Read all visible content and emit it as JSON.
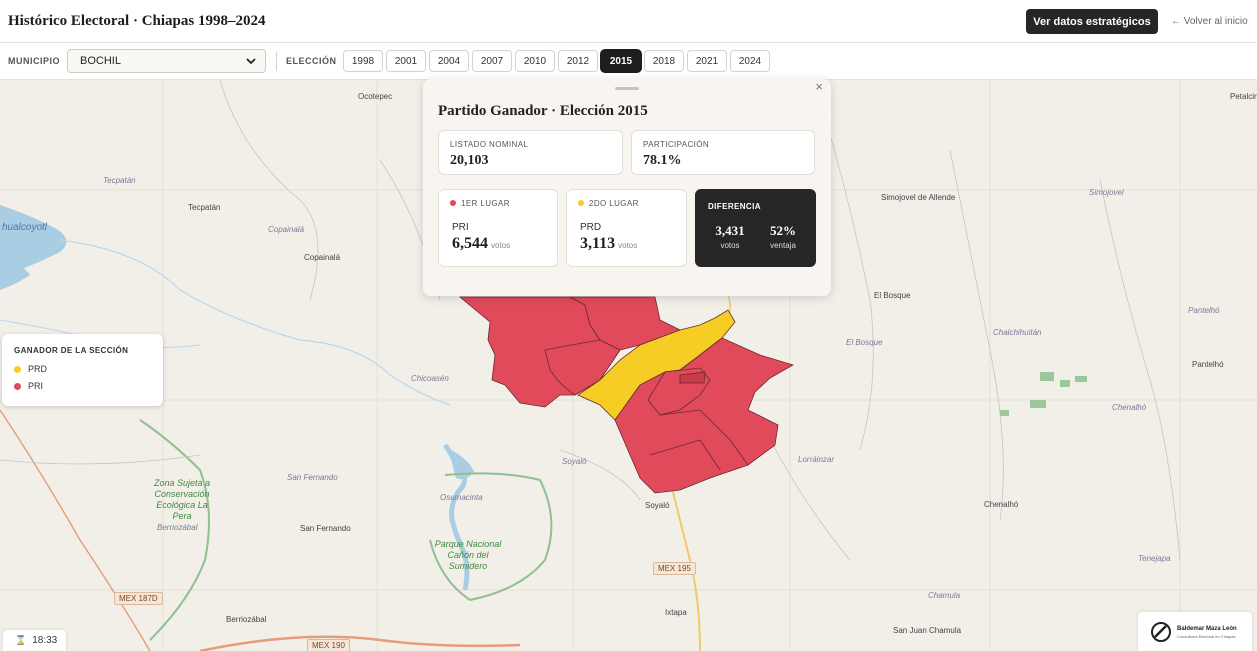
{
  "header": {
    "title": "Histórico Electoral · Chiapas 1998–2024",
    "strategic_button": "Ver datos estratégicos",
    "back_link": "← Volver al inicio"
  },
  "toolbar": {
    "municipio_label": "MUNICIPIO",
    "municipio_value": "BOCHIL",
    "eleccion_label": "ELECCIÓN",
    "years": [
      "1998",
      "2001",
      "2004",
      "2007",
      "2010",
      "2012",
      "2015",
      "2018",
      "2021",
      "2024"
    ],
    "selected_year": "2015"
  },
  "colors": {
    "pri": "#e04a5a",
    "prd": "#f6cd24",
    "dark": "#262626"
  },
  "panel": {
    "title": "Partido Ganador · Elección 2015",
    "close_icon": "×",
    "listado_label": "LISTADO NOMINAL",
    "listado_value": "20,103",
    "participacion_label": "PARTICIPACIÓN",
    "participacion_value": "78.1%",
    "first": {
      "label": "1ER LUGAR",
      "party": "PRI",
      "votes": "6,544",
      "unit": "votos"
    },
    "second": {
      "label": "2DO LUGAR",
      "party": "PRD",
      "votes": "3,113",
      "unit": "votos"
    },
    "diff": {
      "label": "DIFERENCIA",
      "votes": "3,431",
      "votes_unit": "votos",
      "pct": "52%",
      "pct_unit": "ventaja"
    }
  },
  "legend": {
    "title": "GANADOR DE LA SECCIÓN",
    "items": [
      "PRD",
      "PRI"
    ]
  },
  "timer": {
    "icon": "hourglass-icon",
    "time": "18:33"
  },
  "brand": {
    "name": "Baldemar Maza León",
    "subtitle": "Consultoría Electoral en Chiapas",
    "icon": "brand-logo-icon"
  },
  "map": {
    "places": [
      "Ocotepec",
      "Tecpatán",
      "Copainalá",
      "Chicoasén",
      "San Fernando",
      "Berriozábal",
      "Soyaló",
      "Ixtapa",
      "El Bosque",
      "Pantelhó",
      "Chenalhó",
      "San Juan Chamula",
      "Simojovel de Allende",
      "Petalcingo"
    ],
    "italic_places": [
      "Tecpatán",
      "Copainalá",
      "Chicoasén",
      "San Fernando",
      "Berriozábal",
      "Soyaló",
      "Lorráinzar",
      "Chalchihuitán",
      "El Bosque",
      "Simojovel",
      "Pantelhó",
      "Tenejapa",
      "Chamula",
      "Chenalhó",
      "Osumacinta"
    ],
    "water": "hualcoyotl",
    "green_areas": [
      "Zona Sujeta a Conservación Ecológica La Pera",
      "Parque Nacional Cañón del Sumidero"
    ],
    "roads": [
      "MEX 187D",
      "MEX 190",
      "MEX 195"
    ]
  }
}
